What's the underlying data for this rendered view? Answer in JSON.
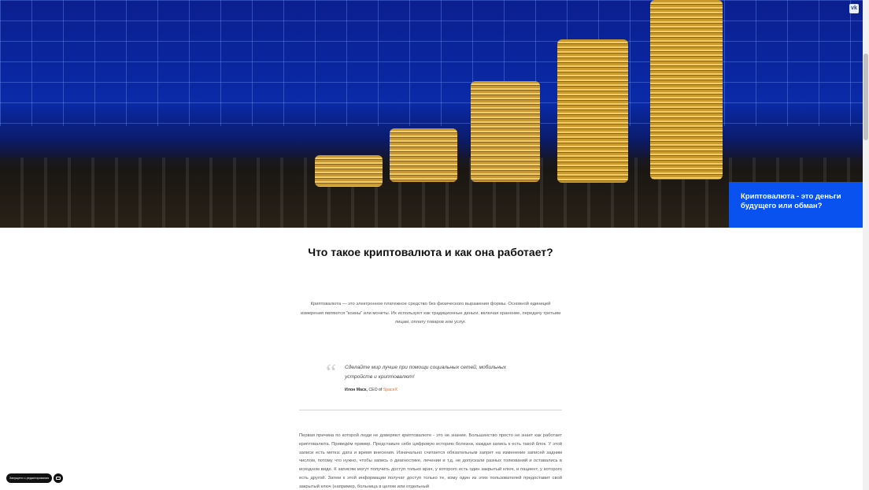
{
  "hero": {
    "social_icon": "vk-icon",
    "card_title": "Криптовалюта - это деньги будущего или обман?"
  },
  "article": {
    "title": "Что такое криптовалюта и как она работает?",
    "intro": "Криптовалюта — это электронное платежное средство без физического выражения формы. Основной единицей измерения являются \"коины\" или монеты. Их используют как традиционные деньги, включая хранение, передачу третьим лицам, оплату товаров или услуг.",
    "quote": {
      "text": "Сделайте мир лучше при помощи социальных сетей, мобильных устройств и криптовалют!",
      "author_name": "Илон Маск,",
      "author_role": "CEO of",
      "author_company": "SpaceX"
    },
    "body": "Первая причина по которой люди не доверяют криптовалюте - это не знание. Большинство просто не знает как работает криптовалюта. Приведём пример. Представьте себе цифровую историю болезни, каждая запись к есть такой блок. У этой записи есть метка: дата и время внесения. Изначально считается обязательным запрет на изменение записей задним числом, потому что нужно, чтобы запись о диагностике, лечении и т.д. не допускали разных толкований и оставались в исходном виде. К записям могут получить доступ только врач, у которого есть один закрытый ключ, и пациент, у которого есть другой. Затем к этой информации получат доступ только те, кому один из этих пользователей предоставит свой закрытый ключ (например, больница в целом или отдельный"
  },
  "footer": {
    "edit_label": "Запущено с редактирования"
  }
}
